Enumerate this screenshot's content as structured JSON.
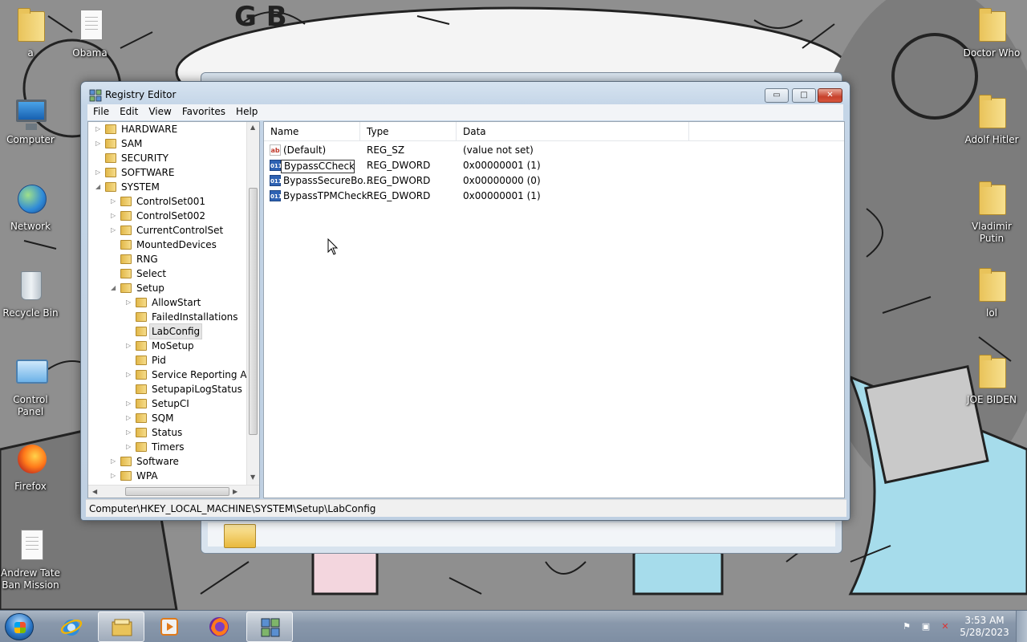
{
  "desktop": {
    "left_icons": [
      {
        "label": "a"
      },
      {
        "label": "Obama"
      },
      {
        "label": "Computer"
      },
      {
        "label": "Network"
      },
      {
        "label": "Recycle Bin"
      },
      {
        "label": "Control Panel"
      },
      {
        "label": "Firefox"
      },
      {
        "label": "Andrew Tate Ban Mission"
      }
    ],
    "right_icons": [
      {
        "label": "Doctor Who"
      },
      {
        "label": "Adolf Hitler"
      },
      {
        "label": "Vladimir Putin"
      },
      {
        "label": "lol"
      },
      {
        "label": "JOE BIDEN"
      }
    ]
  },
  "window": {
    "title": "Registry Editor",
    "minimize_label": "▭",
    "maximize_label": "□",
    "close_label": "✕"
  },
  "menu": [
    "File",
    "Edit",
    "View",
    "Favorites",
    "Help"
  ],
  "tree": [
    {
      "label": "HARDWARE",
      "expander": "▷"
    },
    {
      "label": "SAM",
      "expander": "▷"
    },
    {
      "label": "SECURITY",
      "expander": ""
    },
    {
      "label": "SOFTWARE",
      "expander": "▷"
    },
    {
      "label": "SYSTEM",
      "expander": "◢"
    },
    {
      "label": "ControlSet001",
      "expander": "▷"
    },
    {
      "label": "ControlSet002",
      "expander": "▷"
    },
    {
      "label": "CurrentControlSet",
      "expander": "▷"
    },
    {
      "label": "MountedDevices",
      "expander": ""
    },
    {
      "label": "RNG",
      "expander": ""
    },
    {
      "label": "Select",
      "expander": ""
    },
    {
      "label": "Setup",
      "expander": "◢"
    },
    {
      "label": "AllowStart",
      "expander": "▷"
    },
    {
      "label": "FailedInstallations",
      "expander": ""
    },
    {
      "label": "LabConfig",
      "expander": ""
    },
    {
      "label": "MoSetup",
      "expander": "▷"
    },
    {
      "label": "Pid",
      "expander": ""
    },
    {
      "label": "Service Reporting API",
      "expander": "▷"
    },
    {
      "label": "SetupapiLogStatus",
      "expander": ""
    },
    {
      "label": "SetupCI",
      "expander": "▷"
    },
    {
      "label": "SQM",
      "expander": "▷"
    },
    {
      "label": "Status",
      "expander": "▷"
    },
    {
      "label": "Timers",
      "expander": "▷"
    },
    {
      "label": "Software",
      "expander": "▷"
    },
    {
      "label": "WPA",
      "expander": "▷"
    }
  ],
  "list": {
    "columns": [
      "Name",
      "Type",
      "Data"
    ],
    "rows": [
      {
        "name": "(Default)",
        "type": "REG_SZ",
        "data": "(value not set)",
        "icon": "ab"
      },
      {
        "name": "BypassCCheck",
        "type": "REG_DWORD",
        "data": "0x00000001 (1)",
        "icon": "011"
      },
      {
        "name": "BypassSecureBo...",
        "type": "REG_DWORD",
        "data": "0x00000000 (0)",
        "icon": "011"
      },
      {
        "name": "BypassTPMCheck",
        "type": "REG_DWORD",
        "data": "0x00000001 (1)",
        "icon": "011"
      }
    ]
  },
  "statusbar": {
    "path": "Computer\\HKEY_LOCAL_MACHINE\\SYSTEM\\Setup\\LabConfig"
  },
  "taskbar": {
    "time": "3:53 AM",
    "date": "5/28/2023"
  },
  "colors": {
    "title_bar": "#c4d5e7",
    "close_button": "#c7412c",
    "selection": "#e5e5e5"
  }
}
